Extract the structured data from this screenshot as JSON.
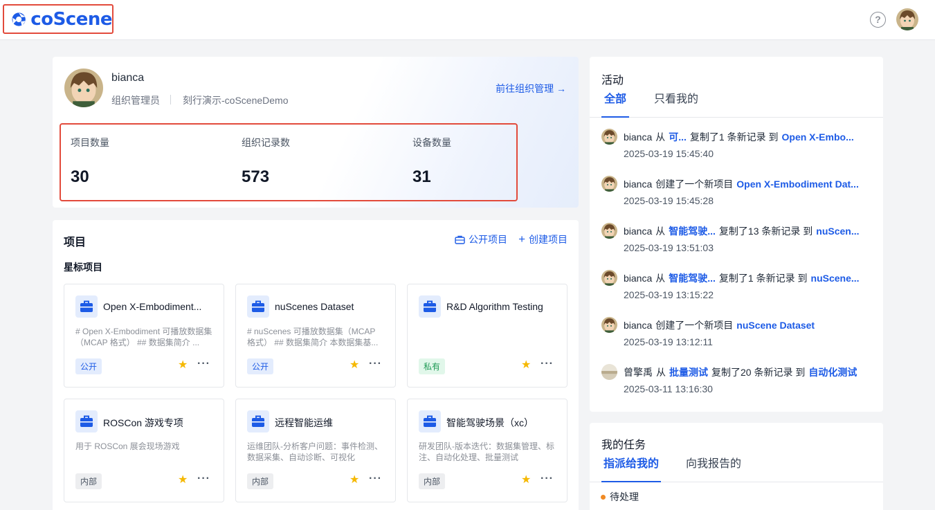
{
  "app": {
    "logo_text": "coScene",
    "brand_color": "#1d5be6",
    "highlight_color": "#e24a3b"
  },
  "header": {
    "help_icon": "help-circle-icon",
    "help_glyph": "?",
    "avatar_icon": "user-avatar"
  },
  "profile": {
    "name": "bianca",
    "role": "组织管理员",
    "org": "刻行演示-coSceneDemo",
    "goto_link": "前往组织管理 →",
    "stats": [
      {
        "label": "项目数量",
        "value": "30"
      },
      {
        "label": "组织记录数",
        "value": "573"
      },
      {
        "label": "设备数量",
        "value": "31"
      }
    ]
  },
  "projects": {
    "title": "项目",
    "public_projects": "公开项目",
    "create_project": "创建项目",
    "starred_title": "星标项目",
    "star_glyph": "★",
    "more_glyph": "···",
    "items": [
      {
        "name": "Open X-Embodiment...",
        "desc": "# Open X-Embodiment 可播放数据集（MCAP 格式） ## 数据集简介 ...",
        "badge": "公开",
        "badge_type": "public",
        "starred": true
      },
      {
        "name": "nuScenes Dataset",
        "desc": "# nuScenes 可播放数据集（MCAP 格式） ## 数据集简介 本数据集基...",
        "badge": "公开",
        "badge_type": "public",
        "starred": true
      },
      {
        "name": "R&D Algorithm Testing",
        "desc": "",
        "badge": "私有",
        "badge_type": "private",
        "starred": true
      },
      {
        "name": "ROSCon 游戏专项",
        "desc": "用于 ROSCon 展会现场游戏",
        "badge": "内部",
        "badge_type": "internal",
        "starred": true
      },
      {
        "name": "远程智能运维",
        "desc": "运维团队-分析客户问题：事件检测、数据采集、自动诊断、可视化",
        "badge": "内部",
        "badge_type": "internal",
        "starred": true
      },
      {
        "name": "智能驾驶场景（xc）",
        "desc": "研发团队-版本迭代：数据集管理、标注、自动化处理、批量测试",
        "badge": "内部",
        "badge_type": "internal",
        "starred": true
      }
    ]
  },
  "activity": {
    "title": "活动",
    "tabs": [
      "全部",
      "只看我的"
    ],
    "items": [
      {
        "user": "bianca",
        "pre": "从",
        "src": "可...",
        "mid": "复制了1 条新记录 到",
        "target": "Open X-Embo...",
        "time": "2025-03-19 15:45:40",
        "avatar": "anime"
      },
      {
        "user": "bianca",
        "pre": "创建了一个新项目",
        "src": "",
        "mid": "",
        "target": "Open X-Embodiment Dat...",
        "time": "2025-03-19 15:45:28",
        "avatar": "anime"
      },
      {
        "user": "bianca",
        "pre": "从",
        "src": "智能驾驶...",
        "mid": "复制了13 条新记录 到",
        "target": "nuScen...",
        "time": "2025-03-19 13:51:03",
        "avatar": "anime"
      },
      {
        "user": "bianca",
        "pre": "从",
        "src": "智能驾驶...",
        "mid": "复制了1 条新记录 到",
        "target": "nuScene...",
        "time": "2025-03-19 13:15:22",
        "avatar": "anime"
      },
      {
        "user": "bianca",
        "pre": "创建了一个新项目",
        "src": "",
        "mid": "",
        "target": "nuScene Dataset",
        "time": "2025-03-19 13:12:11",
        "avatar": "anime"
      },
      {
        "user": "曾擎禹",
        "pre": "从",
        "src": "批量测试",
        "mid": "复制了20 条新记录 到",
        "target": "自动化测试",
        "time": "2025-03-11 13:16:30",
        "avatar": "landscape"
      }
    ]
  },
  "tasks": {
    "title": "我的任务",
    "tabs": [
      "指派给我的",
      "向我报告的"
    ],
    "pending": "待处理"
  }
}
